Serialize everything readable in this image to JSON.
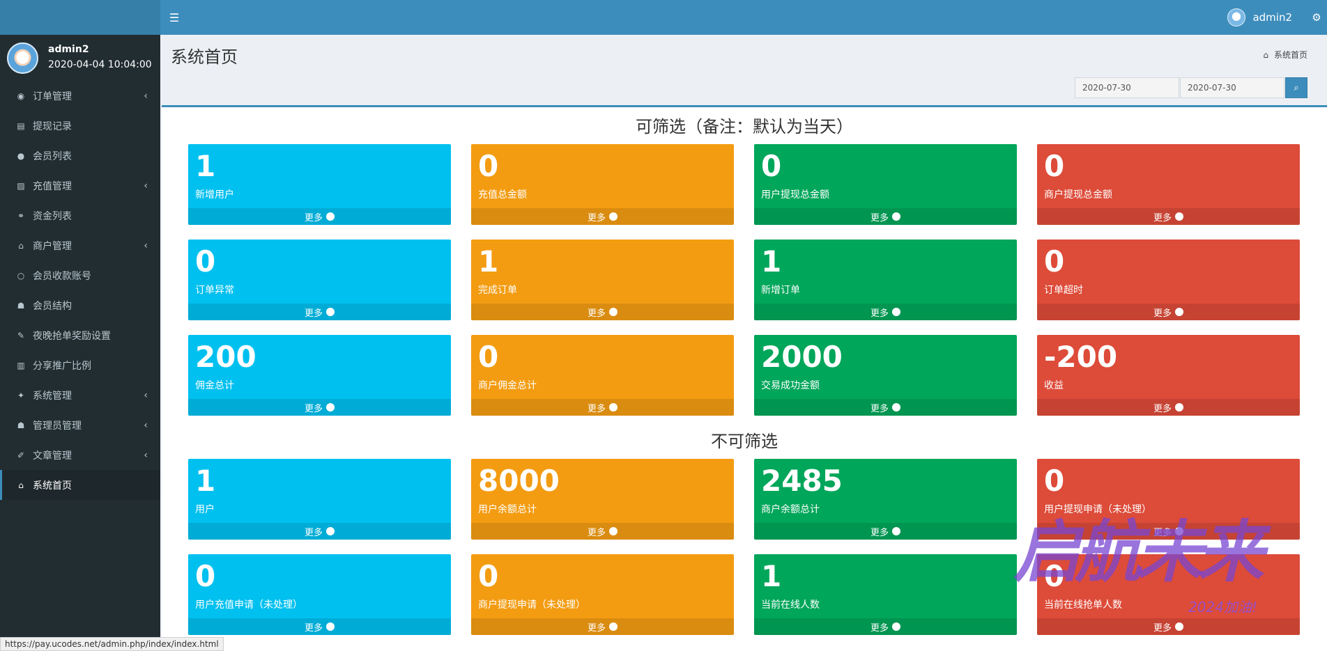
{
  "header": {
    "user": "admin2"
  },
  "sidebar": {
    "user": {
      "name": "admin2",
      "time": "2020-04-04 10:04:00"
    },
    "items": [
      {
        "label": "订单管理",
        "icon": "◉",
        "expandable": true
      },
      {
        "label": "提现记录",
        "icon": "▤",
        "expandable": false
      },
      {
        "label": "会员列表",
        "icon": "●",
        "expandable": false
      },
      {
        "label": "充值管理",
        "icon": "▨",
        "expandable": true
      },
      {
        "label": "资金列表",
        "icon": "⚭",
        "expandable": false
      },
      {
        "label": "商户管理",
        "icon": "⌂",
        "expandable": true
      },
      {
        "label": "会员收款账号",
        "icon": "○",
        "expandable": false
      },
      {
        "label": "会员结构",
        "icon": "☗",
        "expandable": false
      },
      {
        "label": "夜晚抢单奖励设置",
        "icon": "✎",
        "expandable": false
      },
      {
        "label": "分享推广比例",
        "icon": "▥",
        "expandable": false
      },
      {
        "label": "系统管理",
        "icon": "✦",
        "expandable": true
      },
      {
        "label": "管理员管理",
        "icon": "☗",
        "expandable": true
      },
      {
        "label": "文章管理",
        "icon": "✐",
        "expandable": true
      },
      {
        "label": "系统首页",
        "icon": "⌂",
        "expandable": false
      }
    ]
  },
  "page": {
    "title": "系统首页",
    "breadcrumb": "系统首页",
    "date_start": "2020-07-30",
    "date_end": "2020-07-30"
  },
  "sections": {
    "filterable_title": "可筛选（备注：默认为当天）",
    "unfilterable_title": "不可筛选"
  },
  "more_label": "更多",
  "stats_filterable": [
    {
      "value": "1",
      "label": "新增用户",
      "color": "aqua"
    },
    {
      "value": "0",
      "label": "充值总金额",
      "color": "yellow"
    },
    {
      "value": "0",
      "label": "用户提现总金额",
      "color": "green"
    },
    {
      "value": "0",
      "label": "商户提现总金额",
      "color": "red"
    },
    {
      "value": "0",
      "label": "订单异常",
      "color": "aqua"
    },
    {
      "value": "1",
      "label": "完成订单",
      "color": "yellow"
    },
    {
      "value": "1",
      "label": "新增订单",
      "color": "green"
    },
    {
      "value": "0",
      "label": "订单超时",
      "color": "red"
    },
    {
      "value": "200",
      "label": "佣金总计",
      "color": "aqua"
    },
    {
      "value": "0",
      "label": "商户佣金总计",
      "color": "yellow"
    },
    {
      "value": "2000",
      "label": "交易成功金额",
      "color": "green"
    },
    {
      "value": "-200",
      "label": "收益",
      "color": "red"
    }
  ],
  "stats_unfilterable": [
    {
      "value": "1",
      "label": "用户",
      "color": "aqua"
    },
    {
      "value": "8000",
      "label": "用户余额总计",
      "color": "yellow"
    },
    {
      "value": "2485",
      "label": "商户余额总计",
      "color": "green"
    },
    {
      "value": "0",
      "label": "用户提现申请（未处理）",
      "color": "red"
    },
    {
      "value": "0",
      "label": "用户充值申请（未处理）",
      "color": "aqua"
    },
    {
      "value": "0",
      "label": "商户提现申请（未处理）",
      "color": "yellow"
    },
    {
      "value": "1",
      "label": "当前在线人数",
      "color": "green"
    },
    {
      "value": "0",
      "label": "当前在线抢单人数",
      "color": "red"
    }
  ],
  "status_url": "https://pay.ucodes.net/admin.php/index/index.html",
  "watermark": {
    "text": "启航未来",
    "sub": "2024加油!"
  },
  "colors": {
    "aqua": "#00c0ef",
    "yellow": "#f39c12",
    "green": "#00a65a",
    "red": "#dd4b39",
    "header": "#3c8dbc",
    "sidebar": "#222d32"
  }
}
